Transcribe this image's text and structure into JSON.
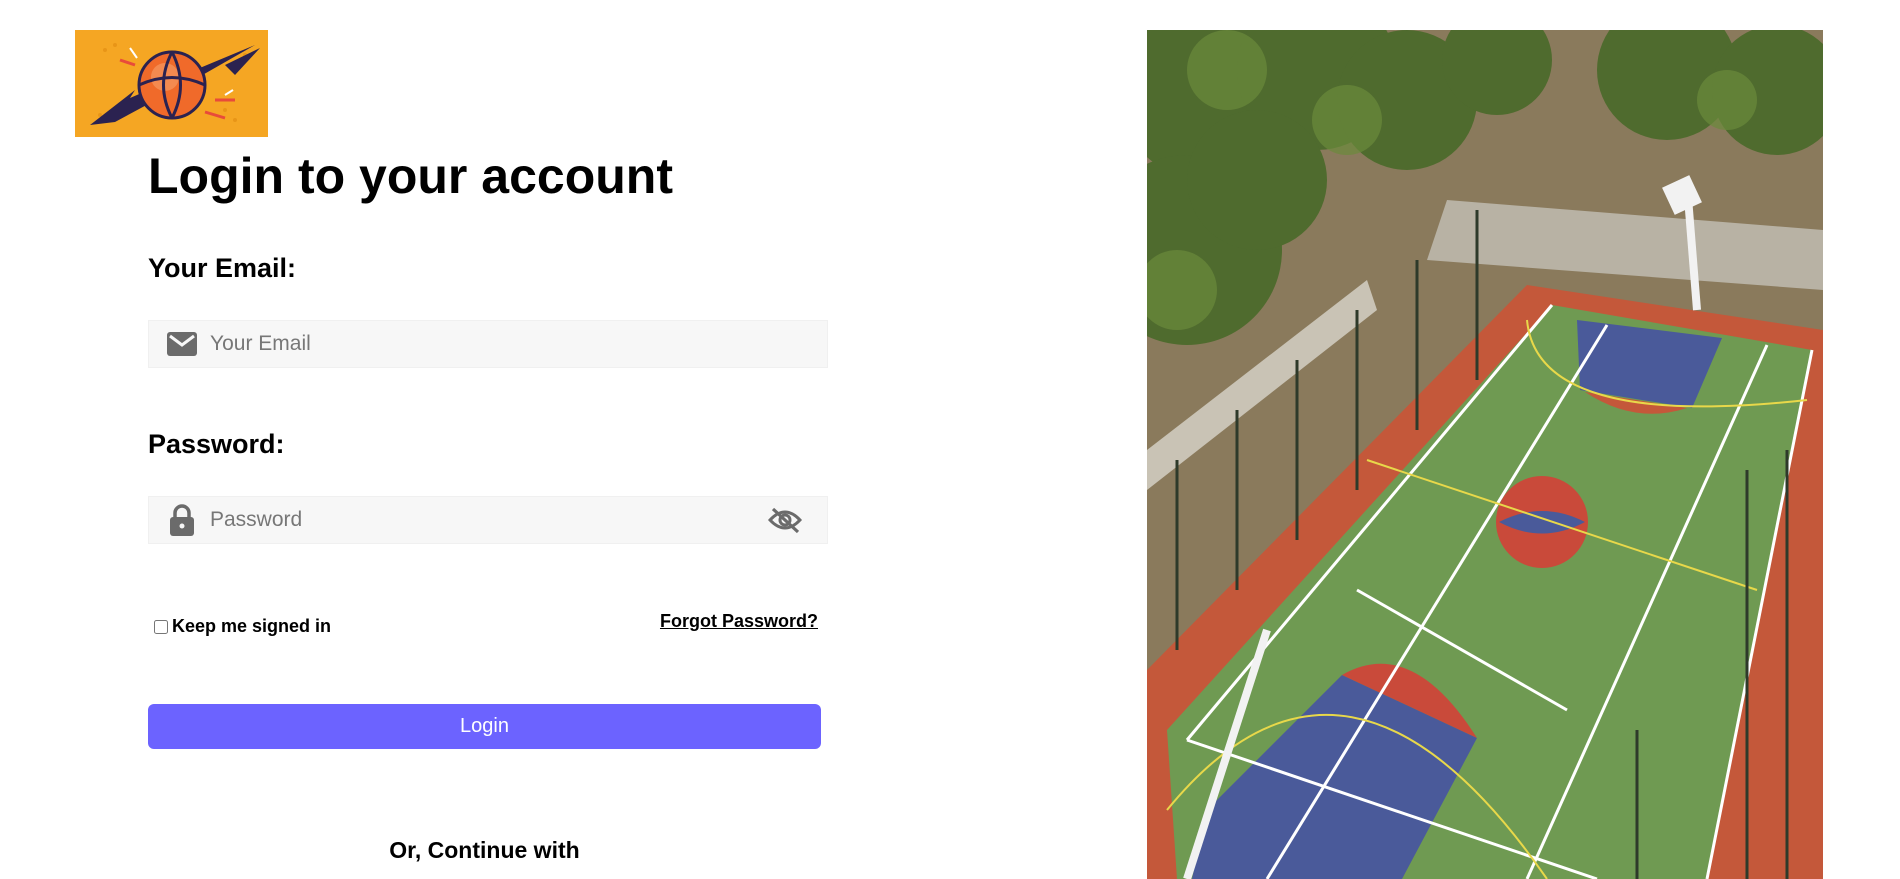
{
  "brand": {
    "logo_icon": "basketball-lightning-logo",
    "background_color": "#f5a623"
  },
  "login": {
    "title": "Login to your account",
    "email_label": "Your Email:",
    "email_placeholder": "Your Email",
    "email_value": "",
    "email_icon": "envelope-icon",
    "password_label": "Password:",
    "password_placeholder": "Password",
    "password_value": "",
    "password_icon": "lock-icon",
    "password_toggle_icon": "eye-off-icon",
    "keep_signed_in_label": "Keep me signed in",
    "keep_signed_in_checked": false,
    "forgot_password_label": "Forgot Password?",
    "submit_label": "Login",
    "submit_color": "#6c63ff",
    "continue_with_label": "Or, Continue with"
  },
  "hero": {
    "image": "aerial-basketball-court-photo"
  }
}
